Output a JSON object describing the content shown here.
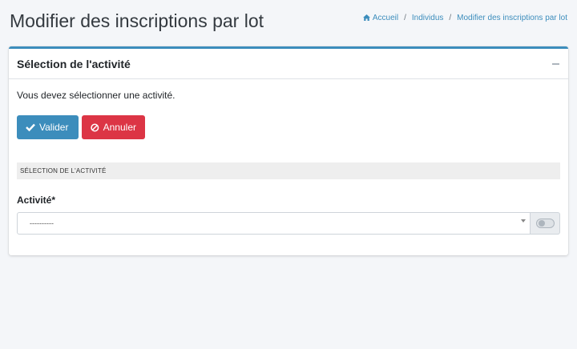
{
  "header": {
    "title": "Modifier des inscriptions par lot",
    "breadcrumb": [
      {
        "label": "Accueil",
        "icon": "home-icon"
      },
      {
        "label": "Individus"
      },
      {
        "label": "Modifier des inscriptions par lot"
      }
    ],
    "separator": "/"
  },
  "card": {
    "title": "Sélection de l'activité",
    "message": "Vous devez sélectionner une activité.",
    "buttons": {
      "validate_label": "Valider",
      "cancel_label": "Annuler"
    },
    "section_title": "SÉLECTION DE L'ACTIVITÉ",
    "field": {
      "label": "Activité*",
      "value": "----------"
    }
  },
  "colors": {
    "primary": "#3c8dbc",
    "danger": "#dc3545",
    "background": "#f4f6f9"
  }
}
